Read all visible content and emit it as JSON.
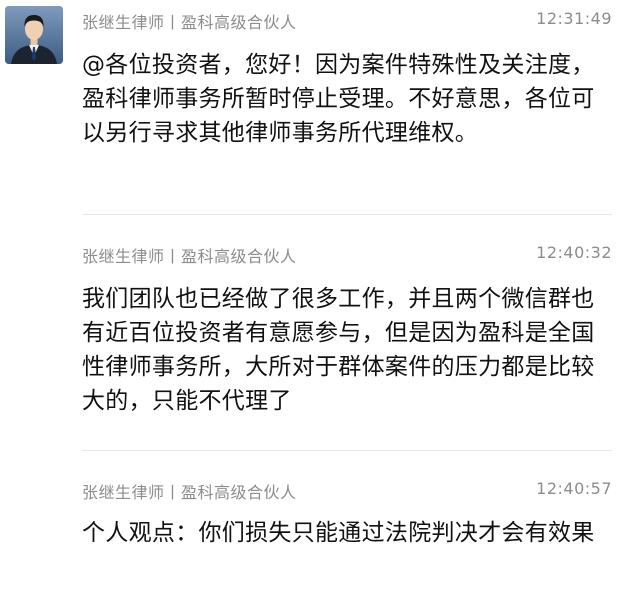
{
  "messages": [
    {
      "sender": "张继生律师丨盈科高级合伙人",
      "time": "12:31:49",
      "text": "@各位投资者，您好！因为案件特殊性及关注度，盈科律师事务所暂时停止受理。不好意思，各位可以另行寻求其他律师事务所代理维权。"
    },
    {
      "sender": "张继生律师丨盈科高级合伙人",
      "time": "12:40:32",
      "text": "我们团队也已经做了很多工作，并且两个微信群也有近百位投资者有意愿参与，但是因为盈科是全国性律师事务所，大所对于群体案件的压力都是比较大的，只能不代理了"
    },
    {
      "sender": "张继生律师丨盈科高级合伙人",
      "time": "12:40:57",
      "text": "个人观点：你们损失只能通过法院判决才会有效果"
    }
  ]
}
